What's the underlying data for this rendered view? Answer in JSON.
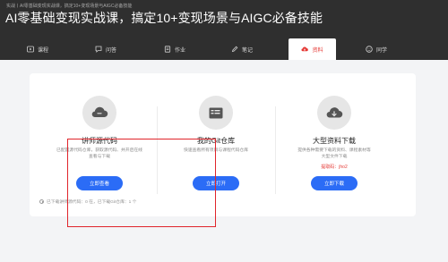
{
  "header": {
    "breadcrumb": "实战丨AI零基础变现实战课，搞定10+变现场景与AIGC必备技能",
    "title": "AI零基础变现实战课，搞定10+变现场景与AIGC必备技能"
  },
  "tabs": [
    {
      "label": "课程",
      "icon": "play-icon"
    },
    {
      "label": "问答",
      "icon": "qa-icon"
    },
    {
      "label": "作业",
      "icon": "homework-icon"
    },
    {
      "label": "笔记",
      "icon": "note-icon"
    },
    {
      "label": "资料",
      "icon": "cloud-download-icon",
      "active": true
    },
    {
      "label": "同学",
      "icon": "classmates-icon"
    }
  ],
  "resources": [
    {
      "title": "讲师源代码",
      "desc_lines": [
        "已配置源代码仓库，获取源代码、并开启在线",
        "查看与下载"
      ],
      "button": "立即查看",
      "icon": "cloud-icon"
    },
    {
      "title": "我的Git仓库",
      "desc_lines": [
        "快速查看所有项目与课程代码仓库"
      ],
      "button": "立即打开",
      "icon": "terminal-icon"
    },
    {
      "title": "大型资料下载",
      "desc_lines": [
        "提供各种需要下载的资料、课程素材等",
        "大型文件下载"
      ],
      "code": "提取码：jho2",
      "button": "立即下载",
      "icon": "cloud-download-icon"
    }
  ],
  "stats": "已下载讲师源代码：0 在，已下载Git仓库：1 个",
  "colors": {
    "header_bg": "#2f2f2f",
    "active_tab": "#e53935",
    "button": "#2b6cf6",
    "annotation": "#e0252b"
  }
}
